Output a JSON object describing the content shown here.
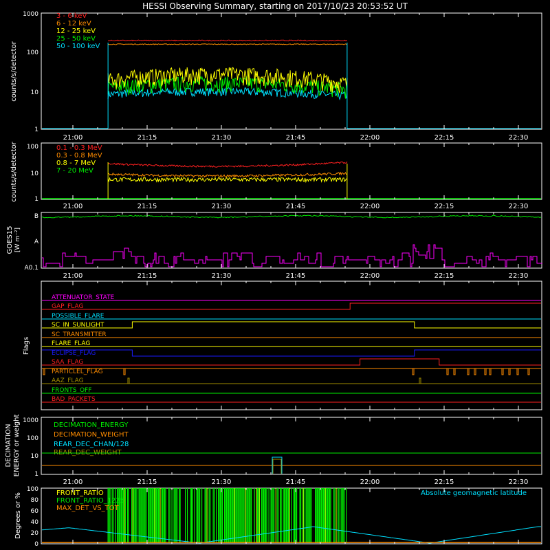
{
  "title": "HESSI Observing Summary, starting on 2017/10/23 20:53:52 UT",
  "time_ticks": [
    "21:00",
    "21:15",
    "21:30",
    "21:45",
    "22:00",
    "22:15",
    "22:30"
  ],
  "colors": {
    "axis": "#ffffff",
    "red": "#ff2020",
    "orange": "#ff8c00",
    "yellow": "#ffff00",
    "green": "#00ee00",
    "cyan": "#00e0ff",
    "magenta": "#ff00ff",
    "blue": "#1a1aff",
    "olive": "#a08c00"
  },
  "panels": {
    "low_energy": {
      "ylabel": "counts/s/detector",
      "ytick_labels": [
        "1",
        "10",
        "100",
        "1000"
      ],
      "legend": [
        "3 - 6 keV",
        "6 - 12 keV",
        "12 - 25 keV",
        "25 - 50 keV",
        "50 - 100 keV"
      ]
    },
    "high_energy": {
      "ylabel": "counts/s/detector",
      "ytick_labels": [
        "1",
        "10",
        "100"
      ],
      "legend": [
        "0.1 - 0.3 MeV",
        "0.3 - 0.8 MeV",
        "0.8 - 7 MeV",
        "7 - 20 MeV"
      ]
    },
    "goes": {
      "ylabel_1": "GOES15",
      "ylabel_2": "[W m⁻²]",
      "ytick_labels": [
        "B",
        "A",
        "A0.1"
      ]
    },
    "flags": {
      "ylabel": "Flags",
      "names": [
        "ATTENUATOR_STATE",
        "GAP_FLAG",
        "POSSIBLE_FLARE",
        "SC_IN_SUNLIGHT",
        "SC_TRANSMITTER",
        "FLARE_FLAG",
        "ECLIPSE_FLAG",
        "SAA_FLAG",
        "PARTICLEL_FLAG",
        "AAZ_FLAG",
        "FRONTS_OFF",
        "BAD_PACKETS"
      ]
    },
    "decimation": {
      "ylabel_1": "DECIMATION",
      "ylabel_2": "ENERGY or weight",
      "ytick_labels": [
        "1",
        "10",
        "100",
        "1000"
      ],
      "legend": [
        "DECIMATION_ENERGY",
        "DECIMATION_WEIGHT",
        "REAR_DEC_CHAN/128",
        "REAR_DEC_WEIGHT"
      ]
    },
    "ratio": {
      "ylabel": "Degrees or %",
      "ytick_labels": [
        "0",
        "20",
        "40",
        "60",
        "80",
        "100"
      ],
      "legend": [
        "FRONT_RATIO",
        "FRONT_RATIO_1225",
        "MAX_DET_VS_TOT"
      ],
      "annotation": "Absolute geomagnetic latitude"
    }
  },
  "chart_data": {
    "type": "line",
    "x_unit": "UT",
    "x_range": [
      "20:53:52",
      "22:35"
    ],
    "observation_interval": [
      "21:07",
      "21:56"
    ],
    "low_energy_series": [
      {
        "name": "3 - 6 keV",
        "level": 200
      },
      {
        "name": "6 - 12 keV",
        "level": 160
      },
      {
        "name": "12 - 25 keV",
        "level": 25
      },
      {
        "name": "25 - 50 keV",
        "level": 15
      },
      {
        "name": "50 - 100 keV",
        "level": 9
      }
    ],
    "low_energy_ylim": [
      1,
      1000
    ],
    "high_energy_series": [
      {
        "name": "0.1 - 0.3 MeV",
        "level": 16
      },
      {
        "name": "0.3 - 0.8 MeV",
        "level": 7
      },
      {
        "name": "0.8 - 7 MeV",
        "level": 5
      },
      {
        "name": "7 - 20 MeV",
        "level": 1
      }
    ],
    "high_energy_ylim": [
      1,
      100
    ],
    "flag_transitions": {
      "GAP_FLAG": "21:56",
      "SC_IN_SUNLIGHT": [
        "21:12",
        "22:09"
      ],
      "ECLIPSE_FLAG": [
        "21:12",
        "22:09"
      ],
      "SAA_FLAG": [
        "21:58",
        "22:14"
      ]
    },
    "decimation_ylim": [
      1,
      1000
    ],
    "ratio_ylim": [
      0,
      100
    ]
  }
}
